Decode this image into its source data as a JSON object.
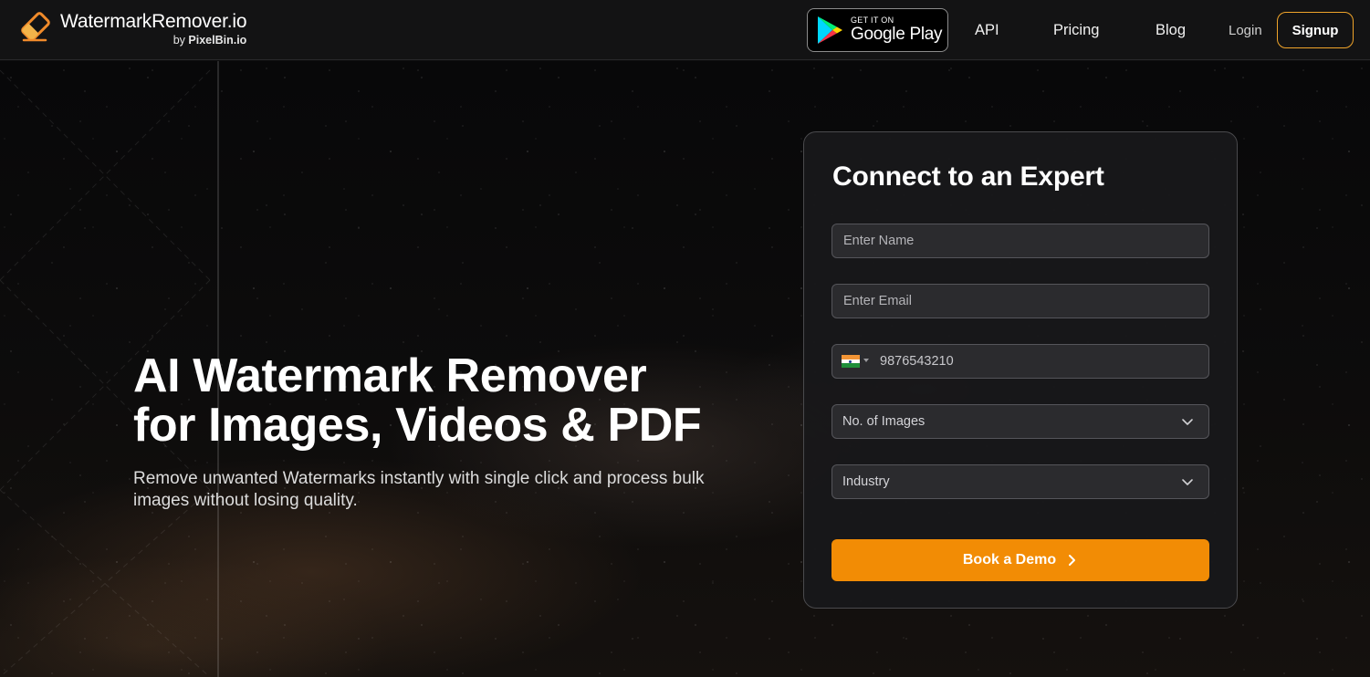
{
  "header": {
    "logo_title": "WatermarkRemover.io",
    "logo_by": "by",
    "logo_brand": "PixelBin.io",
    "google_play": {
      "small": "GET IT ON",
      "big": "Google Play"
    },
    "nav": {
      "api": "API",
      "pricing": "Pricing",
      "blog": "Blog",
      "login": "Login",
      "signup": "Signup"
    }
  },
  "hero": {
    "title_line1": "AI Watermark Remover",
    "title_line2": "for Images, Videos & PDF",
    "subtitle": "Remove unwanted Watermarks instantly with single click and process bulk images without losing quality."
  },
  "form": {
    "title": "Connect to an Expert",
    "name_placeholder": "Enter Name",
    "email_placeholder": "Enter Email",
    "phone_country": "IN",
    "phone_placeholder": "9876543210",
    "images_select": "No. of Images",
    "industry_select": "Industry",
    "submit_label": "Book a Demo"
  },
  "colors": {
    "accent": "#f28c05",
    "signup_border": "#f0a42a",
    "background": "#0b0b0c",
    "card": "#18181a"
  },
  "icons": [
    "logo-eraser-icon",
    "google-play-icon",
    "chevron-down-icon",
    "chevron-right-icon",
    "india-flag-icon"
  ]
}
